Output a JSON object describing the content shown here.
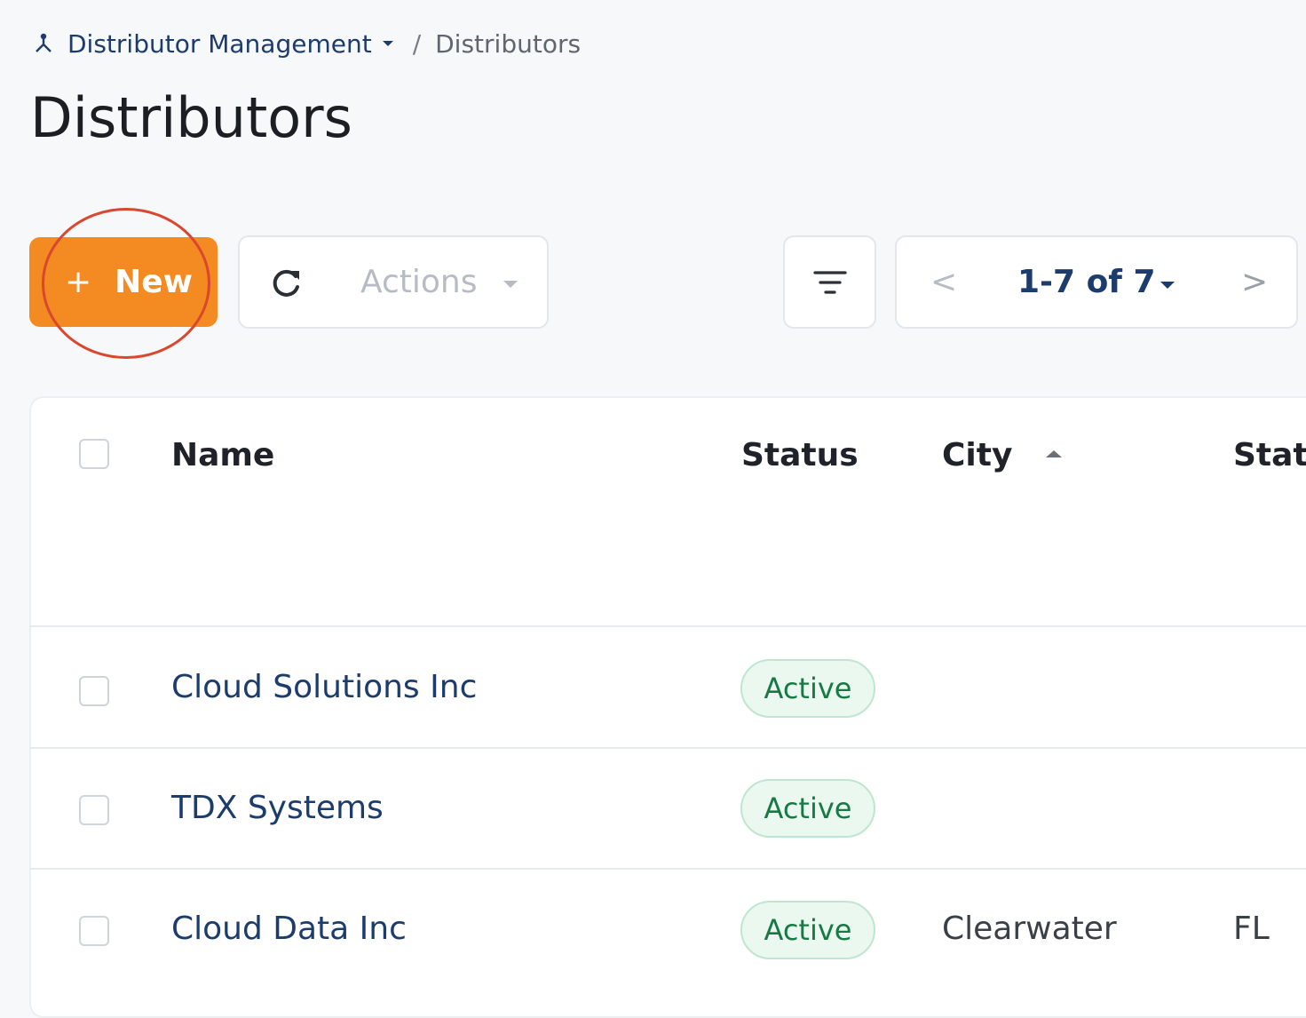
{
  "breadcrumb": {
    "icon": "org-chart-icon",
    "parent": "Distributor Management",
    "separator": "/",
    "current": "Distributors"
  },
  "page": {
    "title": "Distributors"
  },
  "toolbar": {
    "new_plus": "+",
    "new_label": "New",
    "refresh_icon": "refresh-icon",
    "actions_label": "Actions",
    "filter_icon": "filter-icon"
  },
  "pagination": {
    "prev": "<",
    "range": "1-7 of 7",
    "next": ">"
  },
  "table": {
    "columns": [
      {
        "label": "Name"
      },
      {
        "label": "Status"
      },
      {
        "label": "City",
        "sort": "ascending"
      },
      {
        "label": "Stat"
      }
    ],
    "rows": [
      {
        "name": "Cloud Solutions Inc",
        "status": "Active",
        "city": "",
        "state": ""
      },
      {
        "name": "TDX Systems",
        "status": "Active",
        "city": "",
        "state": ""
      },
      {
        "name": "Cloud Data Inc",
        "status": "Active",
        "city": "Clearwater",
        "state": "FL"
      }
    ]
  },
  "colors": {
    "primary": "#f38a22",
    "link": "#1d3c6e",
    "status_active": "#177a45",
    "highlight_ring": "#d9482e"
  }
}
